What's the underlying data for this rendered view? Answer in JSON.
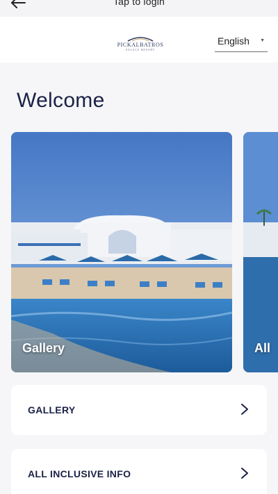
{
  "topbar": {
    "title": "Tap to login"
  },
  "header": {
    "logo_name": "PICKALBATROS",
    "logo_sub": "PALACE RESORT",
    "language": "English"
  },
  "welcome": "Welcome",
  "carousel": [
    {
      "label": "Gallery"
    },
    {
      "label": "All"
    }
  ],
  "menu": [
    {
      "label": "GALLERY"
    },
    {
      "label": "ALL INCLUSIVE INFO"
    }
  ]
}
